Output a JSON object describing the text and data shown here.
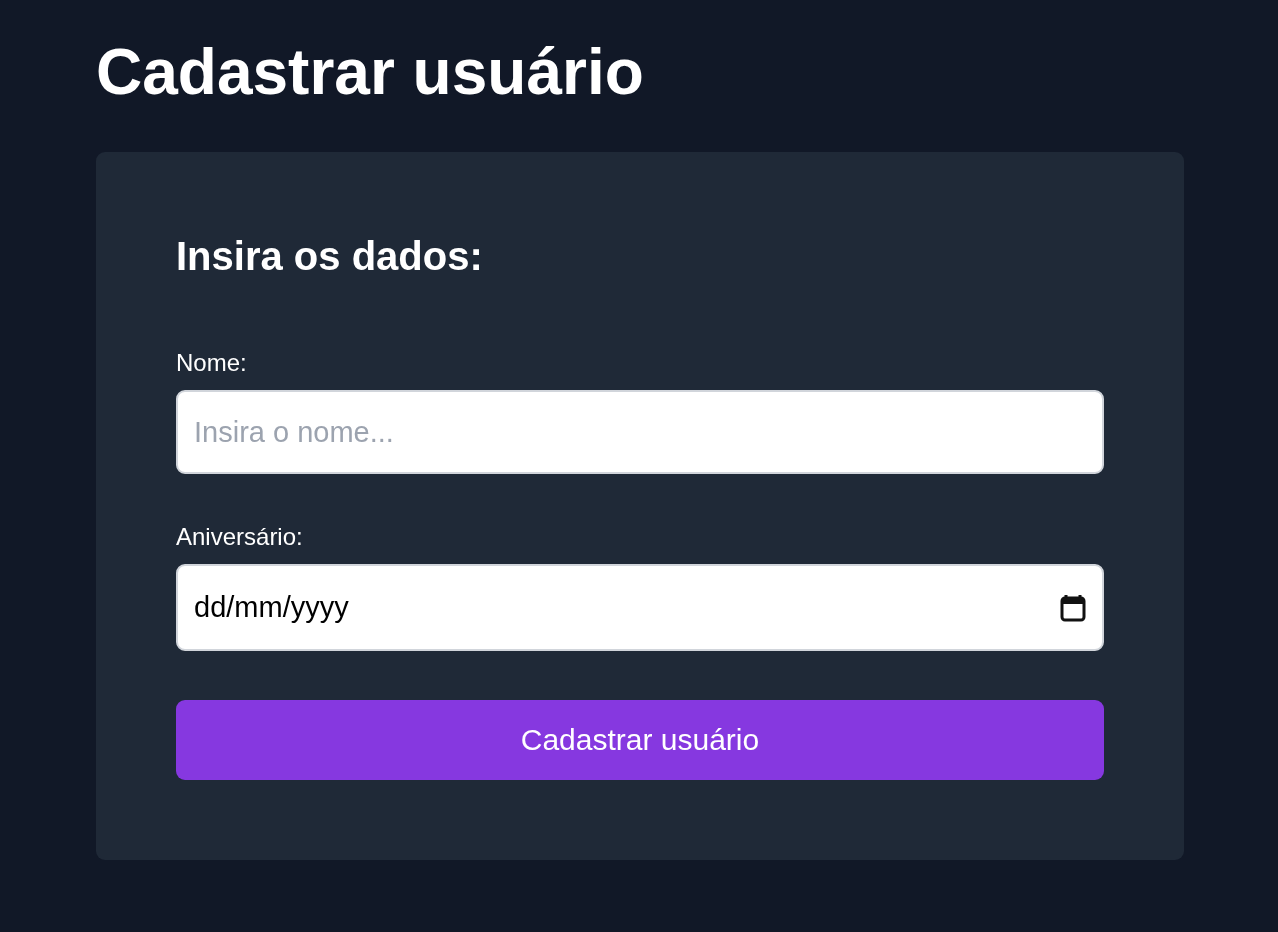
{
  "page_title": "Cadastrar usuário",
  "form": {
    "heading": "Insira os dados:",
    "fields": [
      {
        "kind": "text",
        "label": "Nome:",
        "placeholder": "Insira o nome..."
      },
      {
        "kind": "date",
        "label": "Aniversário:",
        "value": "dd/mm/yyyy"
      }
    ],
    "submit": "Cadastrar usuário"
  }
}
